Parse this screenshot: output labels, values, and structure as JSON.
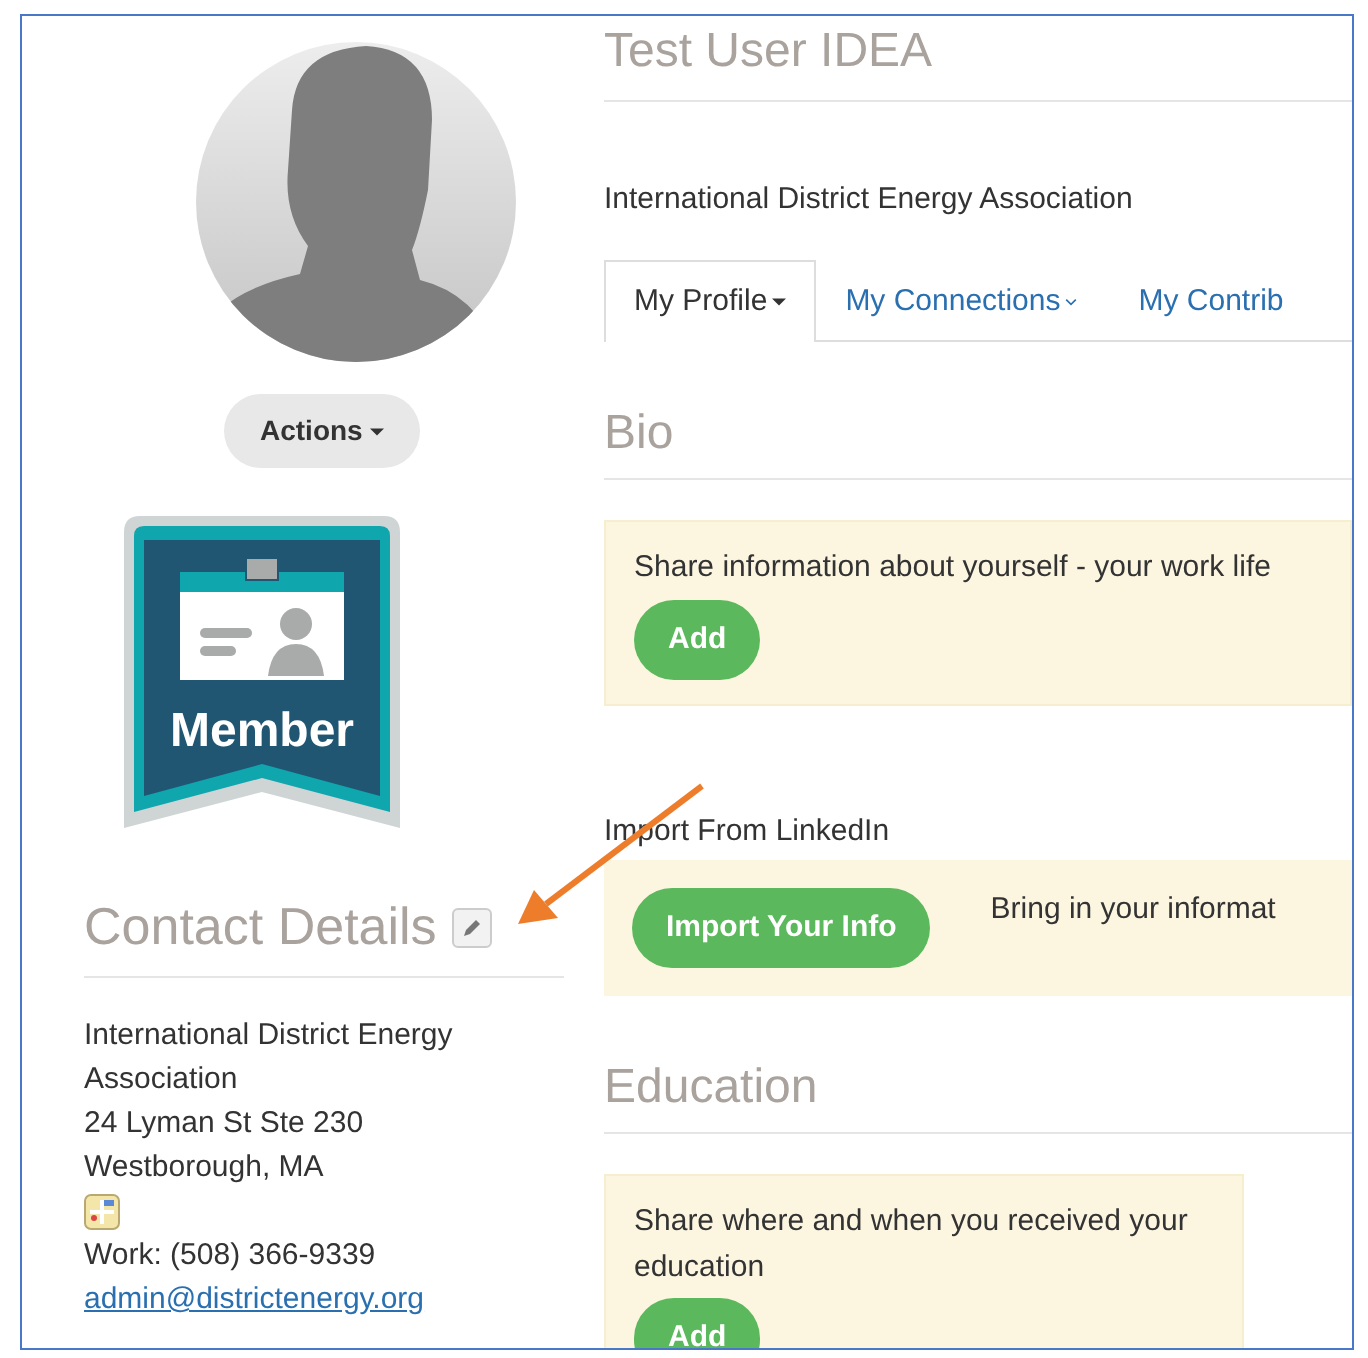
{
  "profile": {
    "actions_button": "Actions",
    "badge": "Member"
  },
  "contact": {
    "title": "Contact Details",
    "lines": [
      "International District Energy Association",
      "24 Lyman St Ste 230",
      "Westborough, MA"
    ],
    "phone": "Work: (508) 366-9339",
    "email": "admin@districtenergy.org"
  },
  "header": {
    "name": "Test User IDEA",
    "organization": "International District Energy Association"
  },
  "tabs": [
    {
      "label": "My Profile",
      "selected": true
    },
    {
      "label": "My Connections",
      "selected": false
    },
    {
      "label": "My Contrib",
      "selected": false
    }
  ],
  "sections": [
    {
      "kind": "heading",
      "title": "Bio"
    },
    {
      "kind": "prompt",
      "text": "Share information about yourself - your work life",
      "button": "Add"
    },
    {
      "kind": "import",
      "label": "Import From LinkedIn",
      "button": "Import Your Info",
      "text": "Bring in your informat"
    },
    {
      "kind": "heading",
      "title": "Education"
    },
    {
      "kind": "prompt",
      "text": "Share where and when you received your education",
      "button": "Add"
    }
  ]
}
